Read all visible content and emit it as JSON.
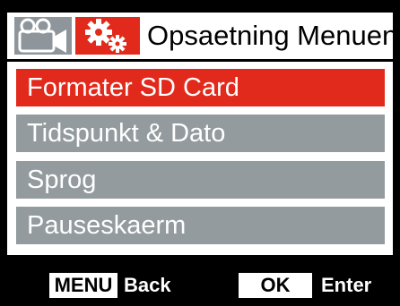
{
  "header": {
    "title": "Opsaetning Menuen",
    "tabs": [
      {
        "icon": "video-camera-icon",
        "active": false
      },
      {
        "icon": "gears-icon",
        "active": true
      }
    ]
  },
  "menu": {
    "items": [
      {
        "label": "Formater SD Card",
        "selected": true
      },
      {
        "label": "Tidspunkt & Dato",
        "selected": false
      },
      {
        "label": "Sprog",
        "selected": false
      },
      {
        "label": "Pauseskaerm",
        "selected": false
      }
    ]
  },
  "footer": {
    "menu_key": "MENU",
    "menu_action": "Back",
    "ok_key": "OK",
    "ok_action": "Enter"
  },
  "colors": {
    "accent": "#e22a1c",
    "item_background": "#939b9f",
    "inactive_tab": "#8e969c",
    "screen_background": "#000000"
  }
}
